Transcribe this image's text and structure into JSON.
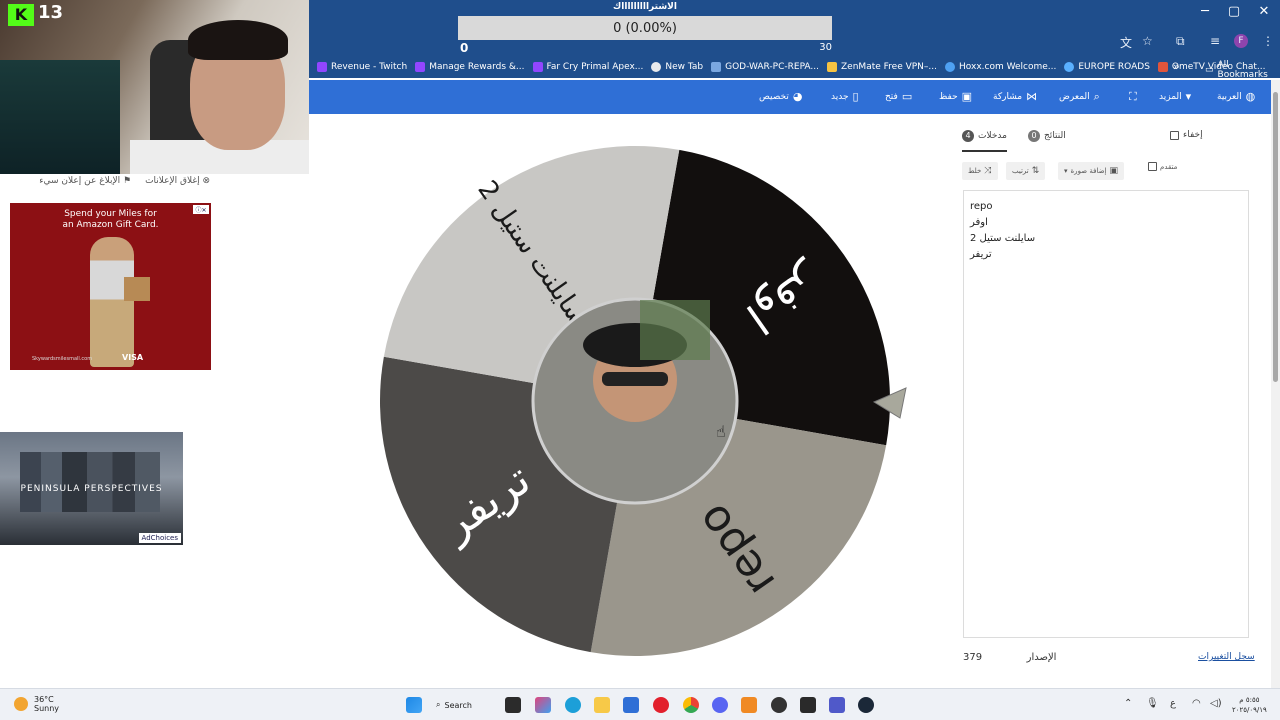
{
  "poll": {
    "title": "الاشتراااااااااك",
    "bar_text": "0 (0.00%)",
    "min": "0",
    "max": "30",
    "progress": 0
  },
  "window": {
    "minimize": "─",
    "maximize": "▢",
    "close": "✕"
  },
  "bookmarks": [
    {
      "label": "Revenue - Twitch",
      "color": "#9146ff"
    },
    {
      "label": "Manage Rewards &...",
      "color": "#9146ff"
    },
    {
      "label": "Far Cry Primal Apex...",
      "color": "#9146ff"
    },
    {
      "label": "New Tab",
      "color": "#e8eaed"
    },
    {
      "label": "GOD-WAR-PC-REPA...",
      "color": "#7aa7e0"
    },
    {
      "label": "ZenMate Free VPN–...",
      "color": "#f6c342"
    },
    {
      "label": "Hoxx.com Welcome...",
      "color": "#4ea1f3"
    },
    {
      "label": "EUROPE ROADS",
      "color": "#5ab0ff"
    },
    {
      "label": "OmeTV Video Chat...",
      "color": "#e0553c"
    }
  ],
  "bookmarks_more": "»",
  "all_bookmarks": "All Bookmarks",
  "toolbar": {
    "language": "العربية",
    "more": "المزيد",
    "gallery": "المعرض",
    "share": "مشاركة",
    "save": "حفظ",
    "open": "فتح",
    "new": "جديد",
    "customize": "تخصيص"
  },
  "webcam": {
    "logo": "K",
    "viewer_count": "13"
  },
  "ads": {
    "close_ads": "إغلاق الإعلانات",
    "report_ad": "الإبلاغ عن إعلان سيء",
    "ad1_line1": "Spend your Miles for",
    "ad1_line2": "an Amazon Gift Card.",
    "ad1_brand": "VISA",
    "ad1_url": "Skywardsmilesmall.com",
    "ad2_text": "PENINSULA PERSPECTIVES",
    "ad2_choices": "AdChoices"
  },
  "wheel": {
    "segments": [
      {
        "label": "اوفر",
        "color": "#120f0e",
        "text_color": "#ffffff"
      },
      {
        "label": "repo",
        "color": "#9a968c",
        "text_color": "#1a1a1a"
      },
      {
        "label": "تريفر",
        "color": "#4c4a48",
        "text_color": "#ffffff"
      },
      {
        "label": "سايلنت ستيل 2",
        "color": "#c8c7c4",
        "text_color": "#1a1a1a"
      }
    ]
  },
  "panel": {
    "hide_label": "إخفاء",
    "tab_results": "النتائج",
    "results_count": "0",
    "tab_entries": "مدخلات",
    "entries_count": "4",
    "advanced_label": "متقدم",
    "add_image": "إضافة صورة",
    "sort": "ترتيب",
    "shuffle": "خلط",
    "entries": [
      "repo",
      "اوفر",
      "سايلنت ستيل 2",
      "تريفر"
    ],
    "version_label": "الإصدار",
    "version_number": "379",
    "changelog": "سجل التغييرات"
  },
  "taskbar": {
    "temperature": "36°C",
    "condition": "Sunny",
    "search": "Search",
    "time": "٥:٥٥ م",
    "date": "٢٠٢٥/٠٩/١٩",
    "input_lang": "ع"
  }
}
